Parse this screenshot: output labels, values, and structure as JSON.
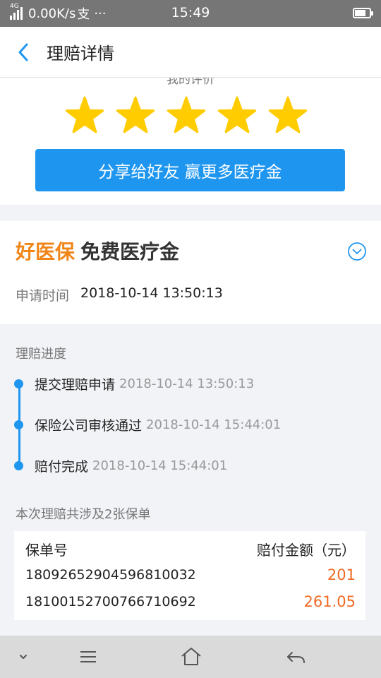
{
  "status_bar": {
    "network_type": "4G",
    "speed": "0.00K/s",
    "app_indicator": "支",
    "more": "···",
    "time": "15:49",
    "battery_level": 0.75
  },
  "header": {
    "title": "理赔详情",
    "back_icon": "chevron-left-icon"
  },
  "rating": {
    "caption": "我的评价",
    "stars_filled": 5,
    "stars_total": 5,
    "star_color": "#ffcc00",
    "share_button": "分享给好友 赢更多医疗金"
  },
  "product": {
    "brand": "好医保",
    "name": "免费医疗金",
    "brand_color": "#f08519",
    "apply_time_label": "申请时间",
    "apply_time_value": "2018-10-14 13:50:13"
  },
  "progress": {
    "title": "理赔进度",
    "steps": [
      {
        "label": "提交理赔申请",
        "time": "2018-10-14 13:50:13"
      },
      {
        "label": "保险公司审核通过",
        "time": "2018-10-14 15:44:01"
      },
      {
        "label": "赔付完成",
        "time": "2018-10-14 15:44:01"
      }
    ]
  },
  "policies": {
    "summary": "本次理赔共涉及2张保单",
    "header_no": "保单号",
    "header_amount": "赔付金额（元）",
    "rows": [
      {
        "no": "18092652904596810032",
        "amount": "201"
      },
      {
        "no": "18100152700766710692",
        "amount": "261.05"
      }
    ]
  },
  "colors": {
    "accent": "#1e96f0",
    "amount": "#f06a24"
  },
  "nav_bar": {
    "icons": [
      "chevron-down-icon",
      "menu-icon",
      "home-icon",
      "back-arrow-icon"
    ]
  }
}
